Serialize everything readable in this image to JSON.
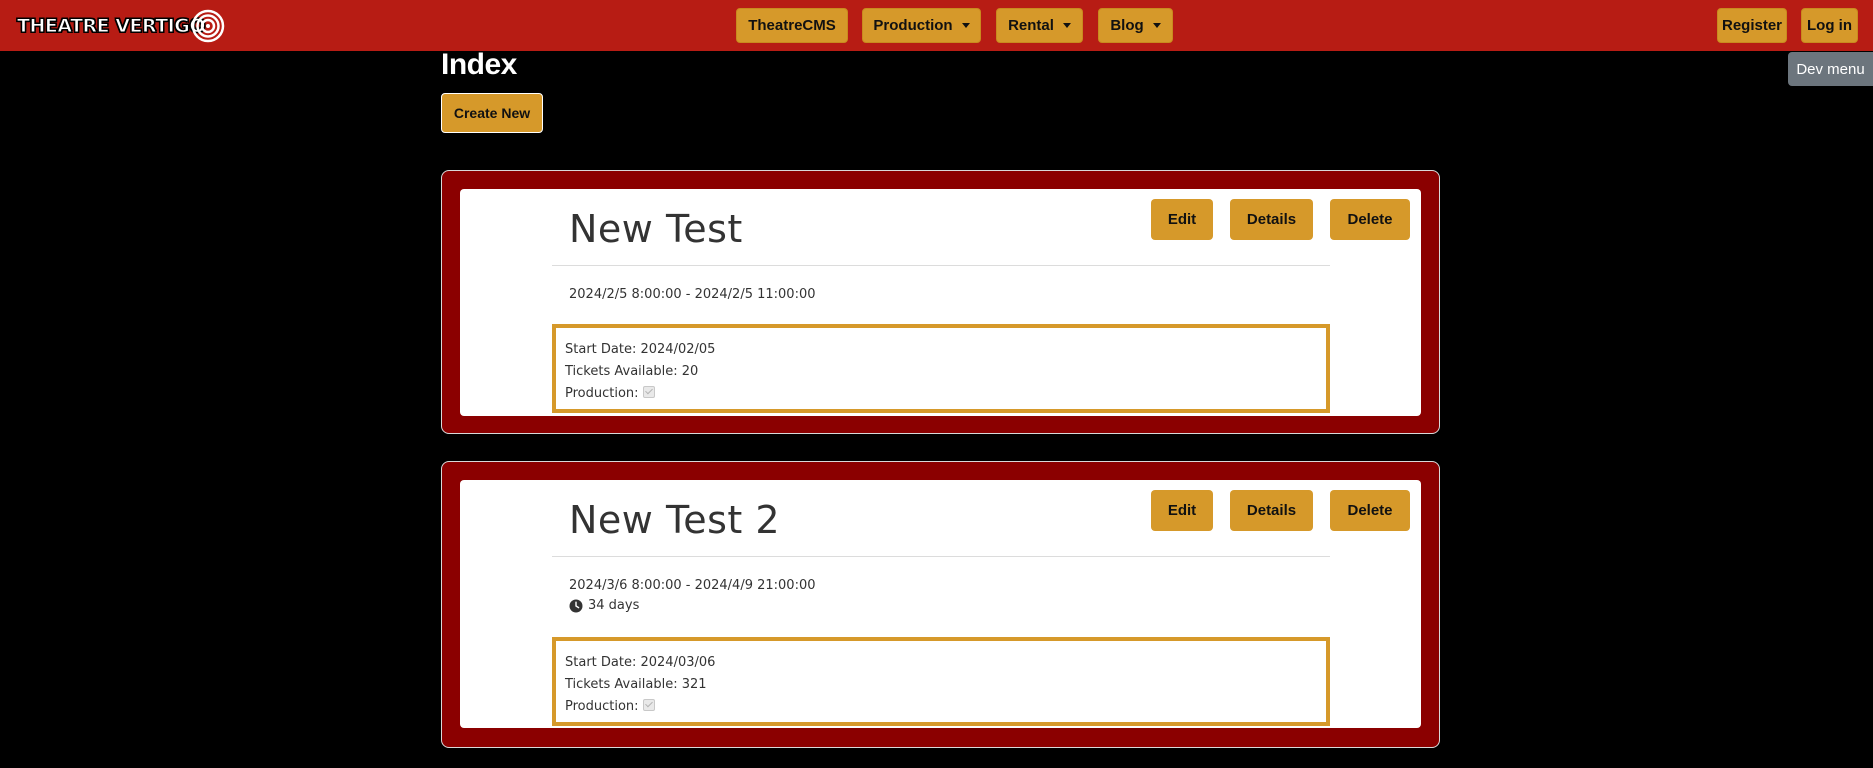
{
  "brand": {
    "name": "THEATRE VERTIGO"
  },
  "nav": {
    "items": [
      {
        "label": "TheatreCMS"
      },
      {
        "label": "Production"
      },
      {
        "label": "Rental"
      },
      {
        "label": "Blog"
      }
    ],
    "register": "Register",
    "login": "Log in"
  },
  "dev_menu": "Dev menu",
  "page": {
    "title": "Index",
    "create_label": "Create New"
  },
  "actions": {
    "edit": "Edit",
    "details": "Details",
    "delete": "Delete"
  },
  "labels": {
    "start_date": "Start Date: ",
    "tickets": "Tickets Available: ",
    "production": "Production:"
  },
  "events": [
    {
      "title": "New Test",
      "range": "2024/2/5 8:00:00 - 2024/2/5 11:00:00",
      "start_date": "2024/02/05",
      "tickets": "20",
      "production_checked": true
    },
    {
      "title": "New Test 2",
      "range": "2024/3/6 8:00:00 - 2024/4/9 21:00:00",
      "duration": "34 days",
      "start_date": "2024/03/06",
      "tickets": "321",
      "production_checked": true
    }
  ],
  "colors": {
    "navbar": "#b71c14",
    "button": "#d6992a",
    "card_frame": "#8b0000",
    "background": "#000000"
  }
}
